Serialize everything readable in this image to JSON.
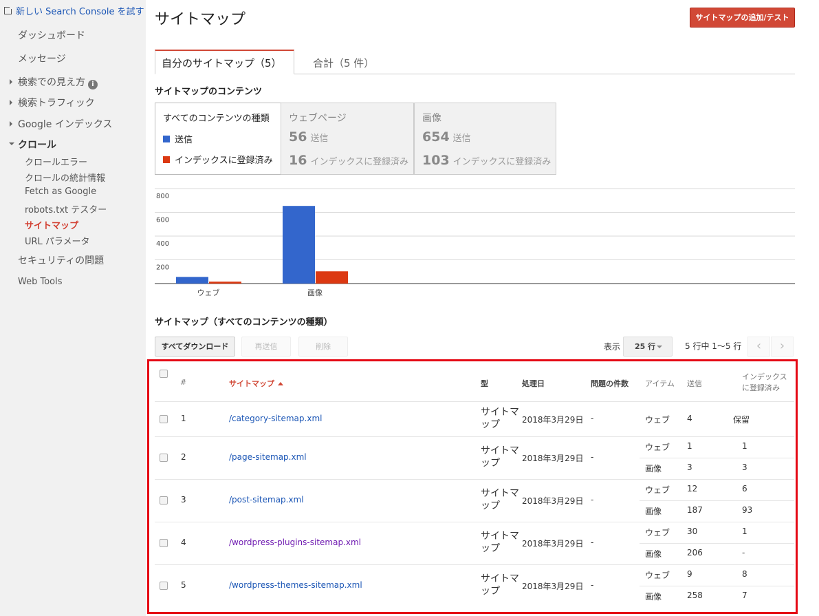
{
  "sidebar": {
    "try_new": "新しい Search Console を試す",
    "dashboard": "ダッシュボード",
    "messages": "メッセージ",
    "search_appearance": "検索での見え方",
    "search_traffic": "検索トラフィック",
    "google_index": "Google インデックス",
    "crawl": "クロール",
    "crawl_sub": [
      "クロールエラー",
      "クロールの統計情報",
      "Fetch as Google",
      "robots.txt テスター",
      "サイトマップ",
      "URL パラメータ"
    ],
    "security": "セキュリティの問題",
    "web_tools": "Web Tools"
  },
  "header": {
    "title": "サイトマップ",
    "add_test_button": "サイトマップの追加/テスト"
  },
  "tabs": {
    "mine": "自分のサイトマップ（5）",
    "total": "合計（5 件）"
  },
  "contents": {
    "title": "サイトマップのコンテンツ",
    "legend_header": "すべてのコンテンツの種類",
    "legend_submitted": "送信",
    "legend_indexed": "インデックスに登録済み",
    "web": {
      "label": "ウェブページ",
      "submitted": "56",
      "indexed": "16",
      "submitted_label": "送信",
      "indexed_label": "インデックスに登録済み"
    },
    "image": {
      "label": "画像",
      "submitted": "654",
      "indexed": "103",
      "submitted_label": "送信",
      "indexed_label": "インデックスに登録済み"
    }
  },
  "colors": {
    "submitted": "#3366cc",
    "indexed": "#dc3912",
    "accent": "#d14836"
  },
  "chart_data": {
    "type": "bar",
    "categories": [
      "ウェブ",
      "画像"
    ],
    "series": [
      {
        "name": "送信",
        "values": [
          56,
          654
        ]
      },
      {
        "name": "インデックスに登録済み",
        "values": [
          16,
          103
        ]
      }
    ],
    "yticks": [
      200,
      400,
      600,
      800
    ],
    "ylim": [
      0,
      800
    ],
    "grid": true
  },
  "table_section": {
    "title": "サイトマップ（すべてのコンテンツの種類）",
    "download_all": "すべてダウンロード",
    "resubmit": "再送信",
    "delete": "削除",
    "display_label": "表示",
    "rows_per_page": "25 行",
    "pagination": "5 行中 1〜5 行"
  },
  "table": {
    "headers": {
      "num": "#",
      "sitemap": "サイトマップ",
      "type": "型",
      "processed": "処理日",
      "issues": "問題の件数",
      "item": "アイテム",
      "submitted": "送信",
      "indexed_line1": "インデックス",
      "indexed_line2": "に登録済み"
    },
    "rows": [
      {
        "num": "1",
        "path": "/category-sitemap.xml",
        "type1": "サイトマ",
        "type2": "ップ",
        "date": "2018年3月29日",
        "issues": "-",
        "items": [
          {
            "item": "ウェブ",
            "submitted": "4",
            "indexed": "保留"
          }
        ]
      },
      {
        "num": "2",
        "path": "/page-sitemap.xml",
        "type1": "サイトマ",
        "type2": "ップ",
        "date": "2018年3月29日",
        "issues": "-",
        "items": [
          {
            "item": "ウェブ",
            "submitted": "1",
            "indexed": "1"
          },
          {
            "item": "画像",
            "submitted": "3",
            "indexed": "3"
          }
        ]
      },
      {
        "num": "3",
        "path": "/post-sitemap.xml",
        "type1": "サイトマ",
        "type2": "ップ",
        "date": "2018年3月29日",
        "issues": "-",
        "items": [
          {
            "item": "ウェブ",
            "submitted": "12",
            "indexed": "6"
          },
          {
            "item": "画像",
            "submitted": "187",
            "indexed": "93"
          }
        ]
      },
      {
        "num": "4",
        "path": "/wordpress-plugins-sitemap.xml",
        "type1": "サイトマ",
        "type2": "ップ",
        "date": "2018年3月29日",
        "issues": "-",
        "items": [
          {
            "item": "ウェブ",
            "submitted": "30",
            "indexed": "1"
          },
          {
            "item": "画像",
            "submitted": "206",
            "indexed": "-"
          }
        ]
      },
      {
        "num": "5",
        "path": "/wordpress-themes-sitemap.xml",
        "type1": "サイトマ",
        "type2": "ップ",
        "date": "2018年3月29日",
        "issues": "-",
        "items": [
          {
            "item": "ウェブ",
            "submitted": "9",
            "indexed": "8"
          },
          {
            "item": "画像",
            "submitted": "258",
            "indexed": "7"
          }
        ]
      }
    ]
  }
}
